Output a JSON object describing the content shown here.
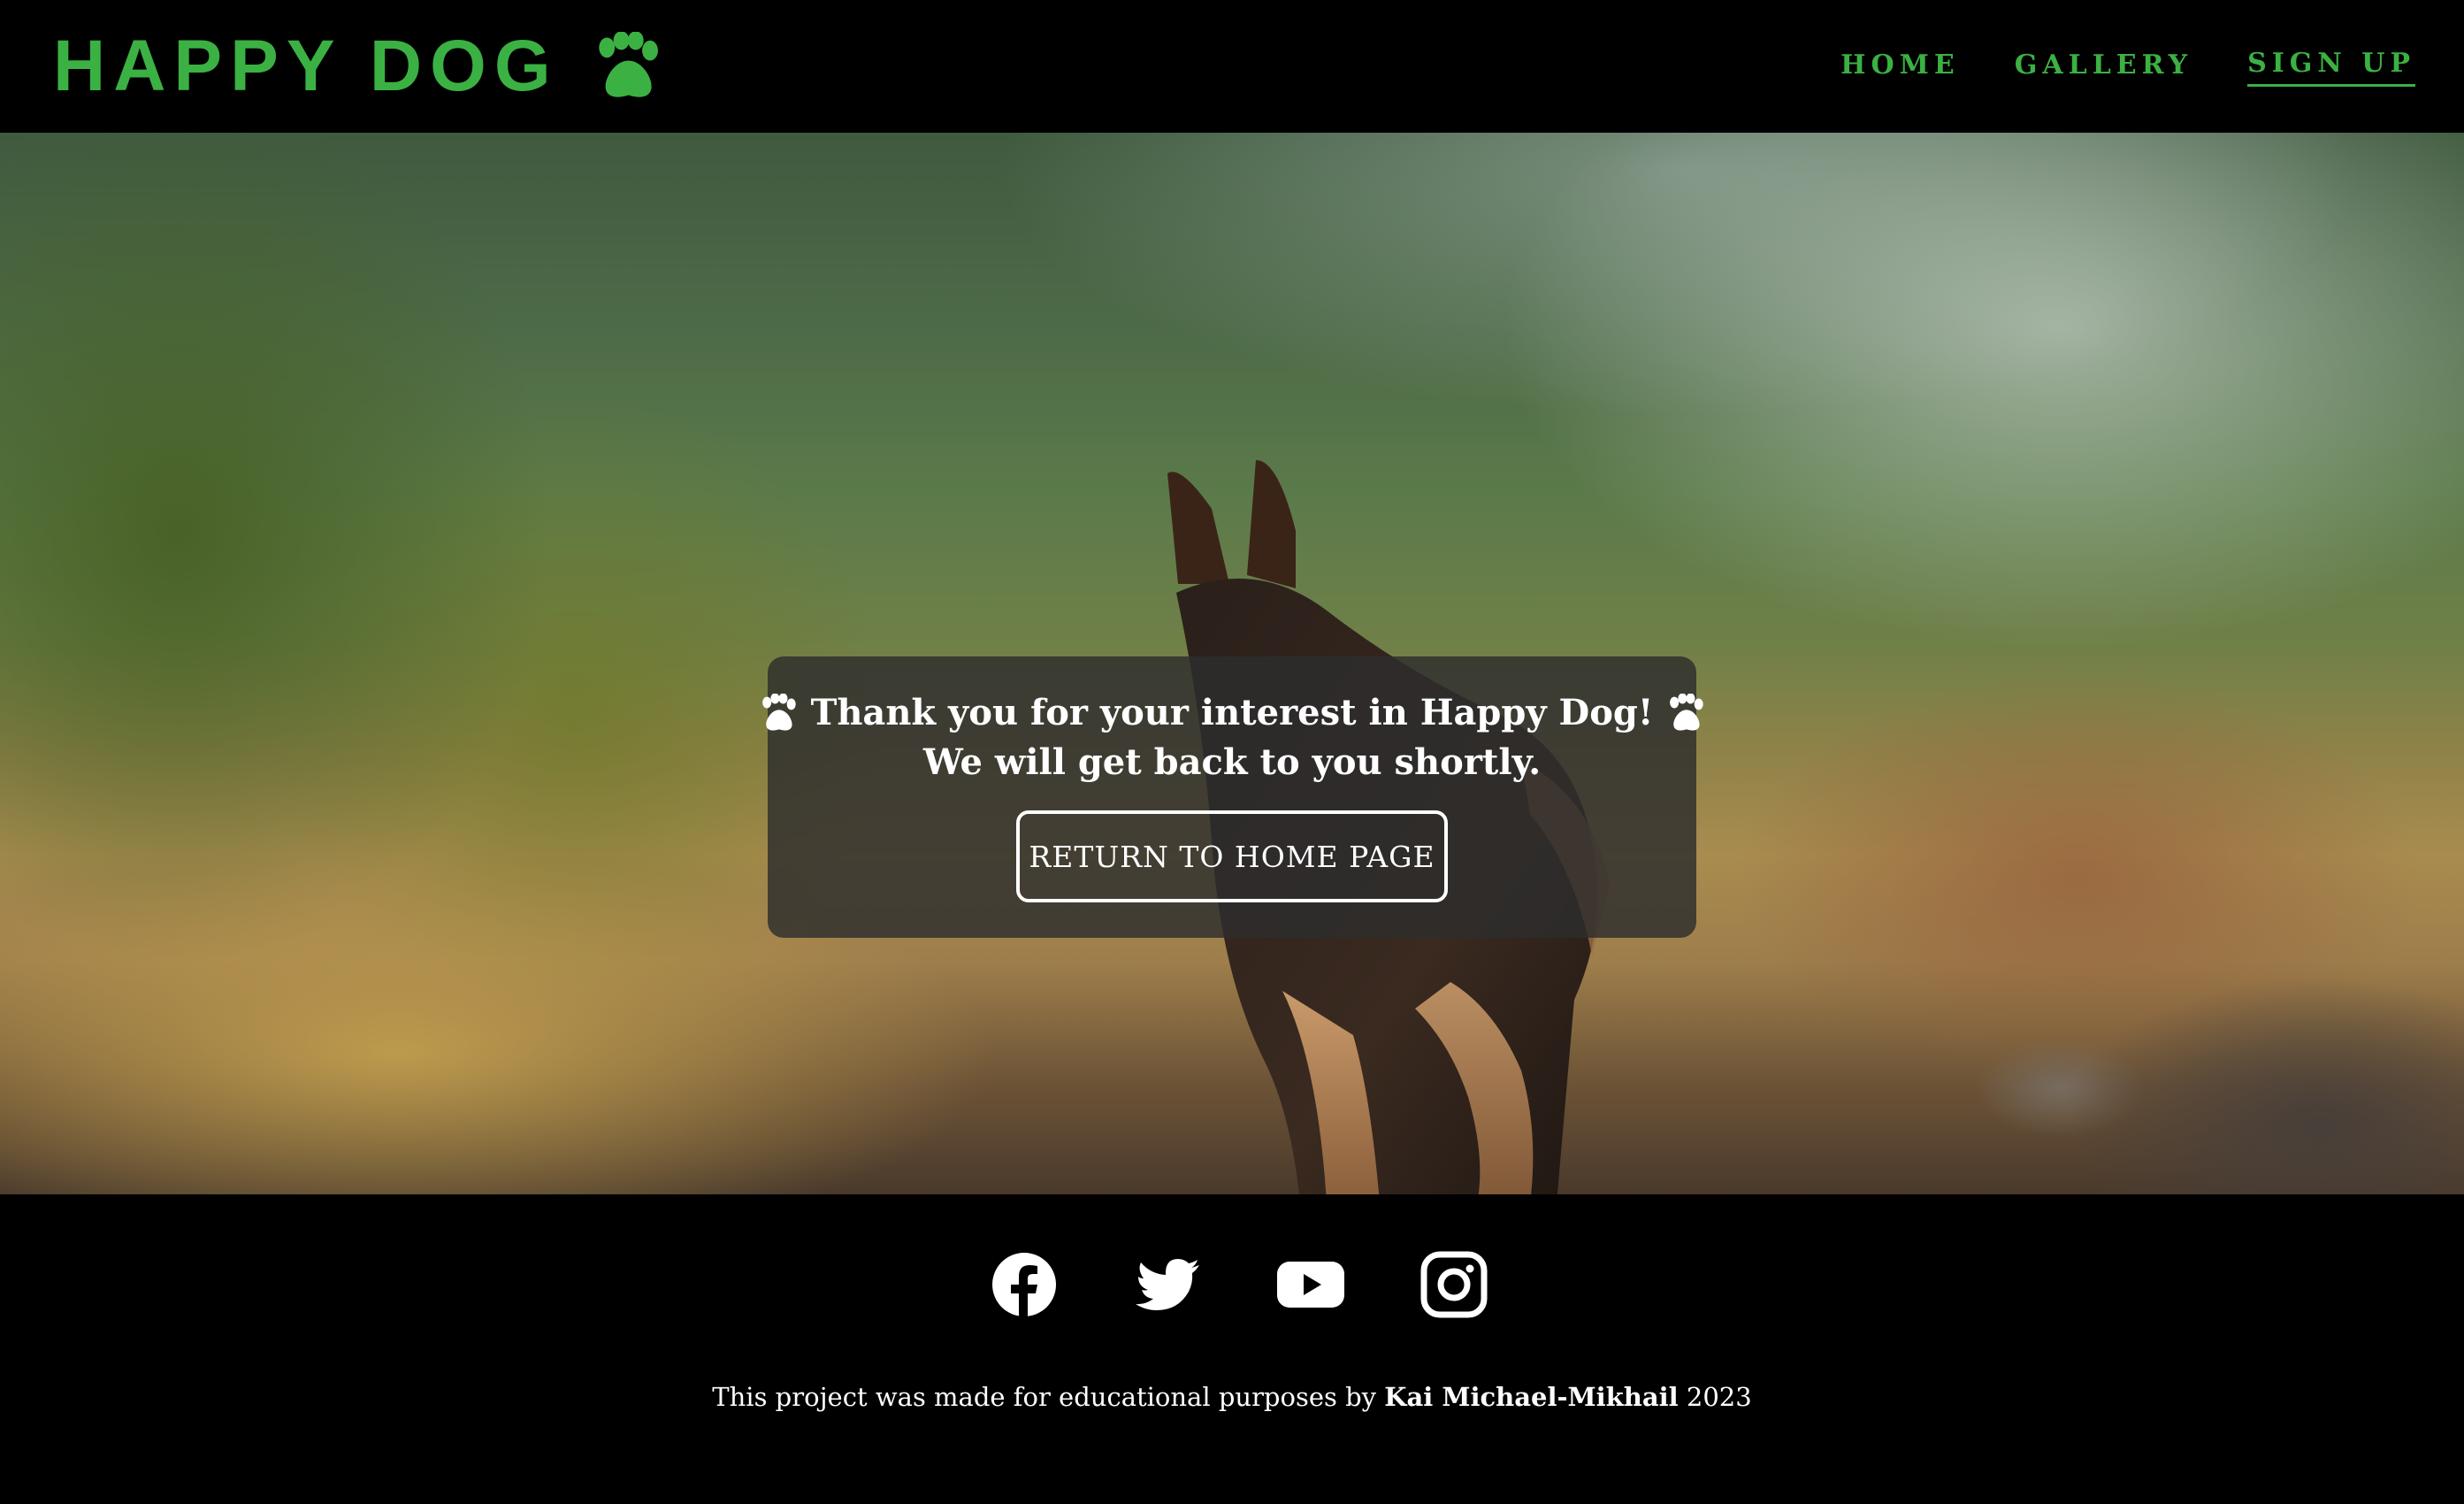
{
  "header": {
    "brand_text": "HAPPY DOG",
    "brand_icon": "paw-icon",
    "nav": [
      {
        "label": "HOME",
        "active": false
      },
      {
        "label": "GALLERY",
        "active": false
      },
      {
        "label": "SIGN UP",
        "active": true
      }
    ]
  },
  "hero": {
    "background_image": "german-shepherd-mountain-photo",
    "message_line1": "Thank you for your interest in Happy Dog!",
    "message_line2": "We will get back to you shortly.",
    "button_label": "RETURN TO HOME PAGE"
  },
  "footer": {
    "socials": [
      "facebook-icon",
      "twitter-icon",
      "youtube-icon",
      "instagram-icon"
    ],
    "credit_prefix": "This project was made for educational purposes by",
    "credit_author": "Kai Michael-Mikhail",
    "credit_year": "2023"
  },
  "colors": {
    "accent": "#3bb143",
    "background": "#000000",
    "card": "#2d2d2d"
  }
}
